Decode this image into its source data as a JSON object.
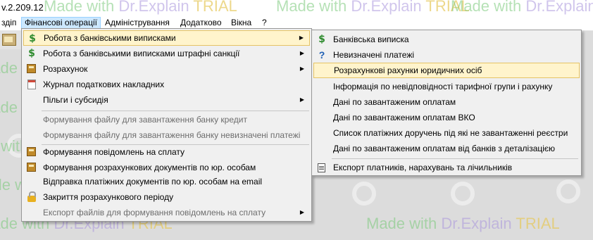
{
  "window": {
    "title": "v.2.209.12"
  },
  "watermark": {
    "prefix": "Made with ",
    "brand": "Dr.Explain",
    "suffix": " TRIAL"
  },
  "menubar": {
    "items": [
      {
        "label": "здіп"
      },
      {
        "label": "Фінансові операції"
      },
      {
        "label": "Адміністрування"
      },
      {
        "label": "Додатково"
      },
      {
        "label": "Вікна"
      },
      {
        "label": "?"
      }
    ]
  },
  "finance_menu": {
    "items": [
      {
        "label": "Робота з банківськими виписками",
        "icon": "dollar-icon",
        "submenu": true
      },
      {
        "label": "Робота з банківськими виписками штрафні санкції",
        "icon": "dollar-icon",
        "submenu": true
      },
      {
        "label": "Розрахунок",
        "icon": "calculator-icon",
        "submenu": true
      },
      {
        "label": "Журнал податкових накладних",
        "icon": "journal-icon",
        "submenu": false
      },
      {
        "label": "Пільги і субсидія",
        "icon": "",
        "submenu": true
      },
      {
        "label": "Формування файлу для завантаження банку кредит",
        "icon": "",
        "disabled": true
      },
      {
        "label": "Формування файлу для завантаження банку невизначені платежі",
        "icon": "",
        "disabled": true
      },
      {
        "label": "Формування повідомлень на сплату",
        "icon": "calculator-icon"
      },
      {
        "label": "Формування розрахункових документів по юр. особам",
        "icon": "calculator-icon"
      },
      {
        "label": "Відправка платіжних документів по юр. особам на email",
        "icon": ""
      },
      {
        "label": "Закриття розрахункового періоду",
        "icon": "lock-icon"
      },
      {
        "label": "Експорт файлів для формування повідомлень на сплату",
        "icon": "",
        "disabled": true,
        "submenu": true
      }
    ],
    "arrow_glyph": "▶"
  },
  "bank_submenu": {
    "items": [
      {
        "label": "Банківська виписка",
        "icon": "dollar-icon"
      },
      {
        "label": "Невизначені платежі",
        "icon": "question-icon"
      },
      {
        "label": "Розрахункові рахунки юридичних осіб",
        "icon": ""
      },
      {
        "label": "Інформація по невідповідності тарифної групи і рахунку",
        "icon": ""
      },
      {
        "label": "Дані по завантаженим оплатам",
        "icon": ""
      },
      {
        "label": "Дані по завантаженим оплатам ВКО",
        "icon": ""
      },
      {
        "label": "Список платіжних доручень під які не завантаженні реєстри",
        "icon": ""
      },
      {
        "label": "Дані по завантаженим оплатам від банків з деталізацією",
        "icon": ""
      },
      {
        "label": "Експорт платників, нарахувань та лічильників",
        "icon": "export-icon"
      }
    ]
  },
  "icons": {
    "dollar": "$",
    "question": "?"
  },
  "colors": {
    "highlight_bg": "#fff4cc",
    "highlight_border": "#e5c365",
    "menubar_active": "#cce8ff"
  }
}
